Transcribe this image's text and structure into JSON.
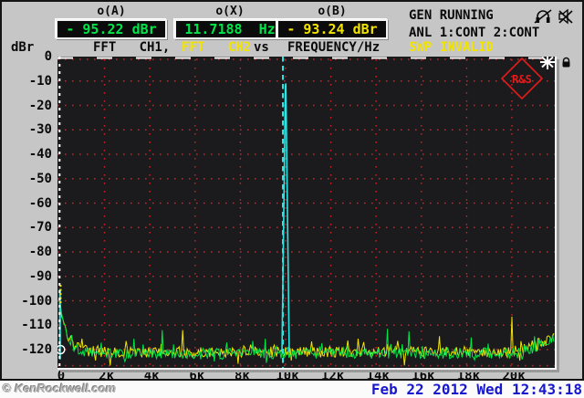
{
  "header": {
    "cursor_a": {
      "label": "o(A)",
      "value": "- 95.22 dBr"
    },
    "cursor_x": {
      "label": "o(X)",
      "value": "11.7188  Hz"
    },
    "cursor_b": {
      "label": "o(B)",
      "value": "- 93.24 dBr"
    },
    "status": {
      "generator": "GEN RUNNING",
      "analyzer": "ANL 1:CONT 2:CONT",
      "sweep": "SWP INVALID"
    },
    "unit_label": "dBr",
    "trace1_label": "FFT   CH1,",
    "trace2_label": "FFT   CH2",
    "vs_label": "vs",
    "xaxis_label": "FREQUENCY/Hz"
  },
  "plot": {
    "logo_text": "R&S"
  },
  "icons": {
    "muted_headphones": "headphones-muted-icon",
    "muted_speaker": "speaker-muted-icon",
    "lock": "lock-icon",
    "star": "star-icon",
    "rs_logo": "rohde-schwarz-logo"
  },
  "footer": {
    "watermark": "© KenRockwell.com",
    "timestamp": "Feb 22 2012 Wed 12:43:18"
  },
  "chart_data": {
    "type": "line",
    "title": "FFT CH1, FFT CH2 vs FREQUENCY/Hz",
    "xlabel": "FREQUENCY/Hz",
    "ylabel": "dBr",
    "xlim_hz": [
      0,
      21850
    ],
    "ylim_db": [
      -127,
      0
    ],
    "x_ticks": [
      "0",
      "2k",
      "4k",
      "6k",
      "8k",
      "10k",
      "12k",
      "14k",
      "16k",
      "18k",
      "20k"
    ],
    "x_tick_hz": [
      0,
      2000,
      4000,
      6000,
      8000,
      10000,
      12000,
      14000,
      16000,
      18000,
      20000
    ],
    "y_ticks": [
      "0",
      "-10",
      "-20",
      "-30",
      "-40",
      "-50",
      "-60",
      "-70",
      "-80",
      "-90",
      "-100",
      "-110",
      "-120"
    ],
    "grid_color": "#d12020",
    "grid_style": "dotted",
    "series": [
      {
        "name": "FFT CH2",
        "color": "#f2e400",
        "noise_floor_db": -121.0,
        "dc_hump_db": 21,
        "right_rise_db": 6,
        "spikes": [
          {
            "f": 1000,
            "db": -115.5
          },
          {
            "f": 2950,
            "db": -116.5
          },
          {
            "f": 5450,
            "db": -112.0
          },
          {
            "f": 13200,
            "db": -115.5
          },
          {
            "f": 16800,
            "db": -114.5
          },
          {
            "f": 20000,
            "db": -106.5
          }
        ]
      },
      {
        "name": "FFT CH1",
        "color": "#00e64a",
        "noise_floor_db": -121.5,
        "dc_hump_db": 22,
        "right_rise_db": 5,
        "spikes": [
          {
            "f": 3300,
            "db": -115.5
          },
          {
            "f": 4550,
            "db": -112.0
          },
          {
            "f": 9100,
            "db": -115.5
          },
          {
            "f": 14500,
            "db": -111.5
          },
          {
            "f": 15450,
            "db": -112.5
          },
          {
            "f": 18200,
            "db": -115.0
          }
        ]
      }
    ],
    "fundamental": {
      "f": 10000,
      "peak_db": -12,
      "base_db": -121,
      "color": "#2be4e4"
    },
    "dc_components": [
      {
        "color": "#2be4e4",
        "f": 30,
        "top_db": -95.2,
        "bottom_db": -124,
        "style": "solid"
      },
      {
        "color": "#f2e400",
        "f": 60,
        "top_db": -93.2,
        "bottom_db": -101,
        "style": "dashed"
      }
    ],
    "cursors": [
      {
        "name": "o-cursor",
        "f": 12,
        "color": "#ffffff",
        "dash": "3 5",
        "marker_db": -120
      },
      {
        "name": "x-cursor",
        "f": 9879,
        "color": "#2be4e4",
        "dash": "5.5 4.5"
      }
    ],
    "zero_line": {
      "color": "#ffffff",
      "style": "dashed"
    }
  }
}
